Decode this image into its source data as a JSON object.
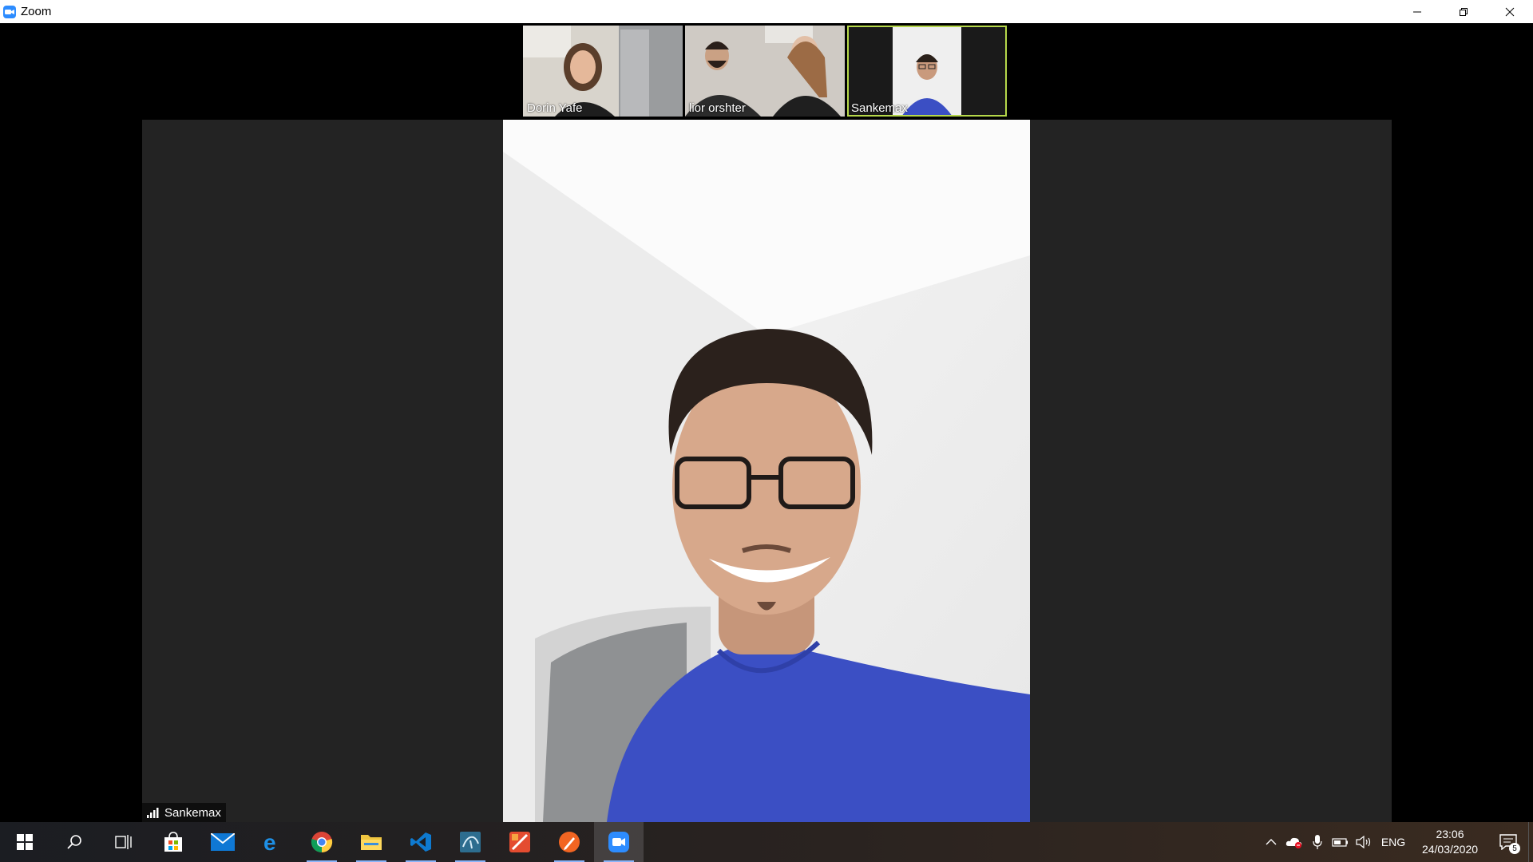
{
  "window": {
    "title": "Zoom"
  },
  "gallery": [
    {
      "name": "Dorin Yafe",
      "active": false
    },
    {
      "name": "lior orshter",
      "active": false
    },
    {
      "name": "Sankemax",
      "active": true
    }
  ],
  "speaker": {
    "name": "Sankemax"
  },
  "taskbar": {
    "apps": [
      "start",
      "search",
      "task-view",
      "store",
      "mail",
      "edge",
      "chrome",
      "file-explorer",
      "vscode",
      "mysql-workbench",
      "app-red",
      "app-orange",
      "zoom"
    ],
    "tray": {
      "language": "ENG",
      "time": "23:06",
      "date": "24/03/2020",
      "notifications": "5"
    }
  },
  "colors": {
    "accent": "#2d8cff",
    "active_border": "#b6d84a",
    "shirt": "#3b4fc4"
  }
}
